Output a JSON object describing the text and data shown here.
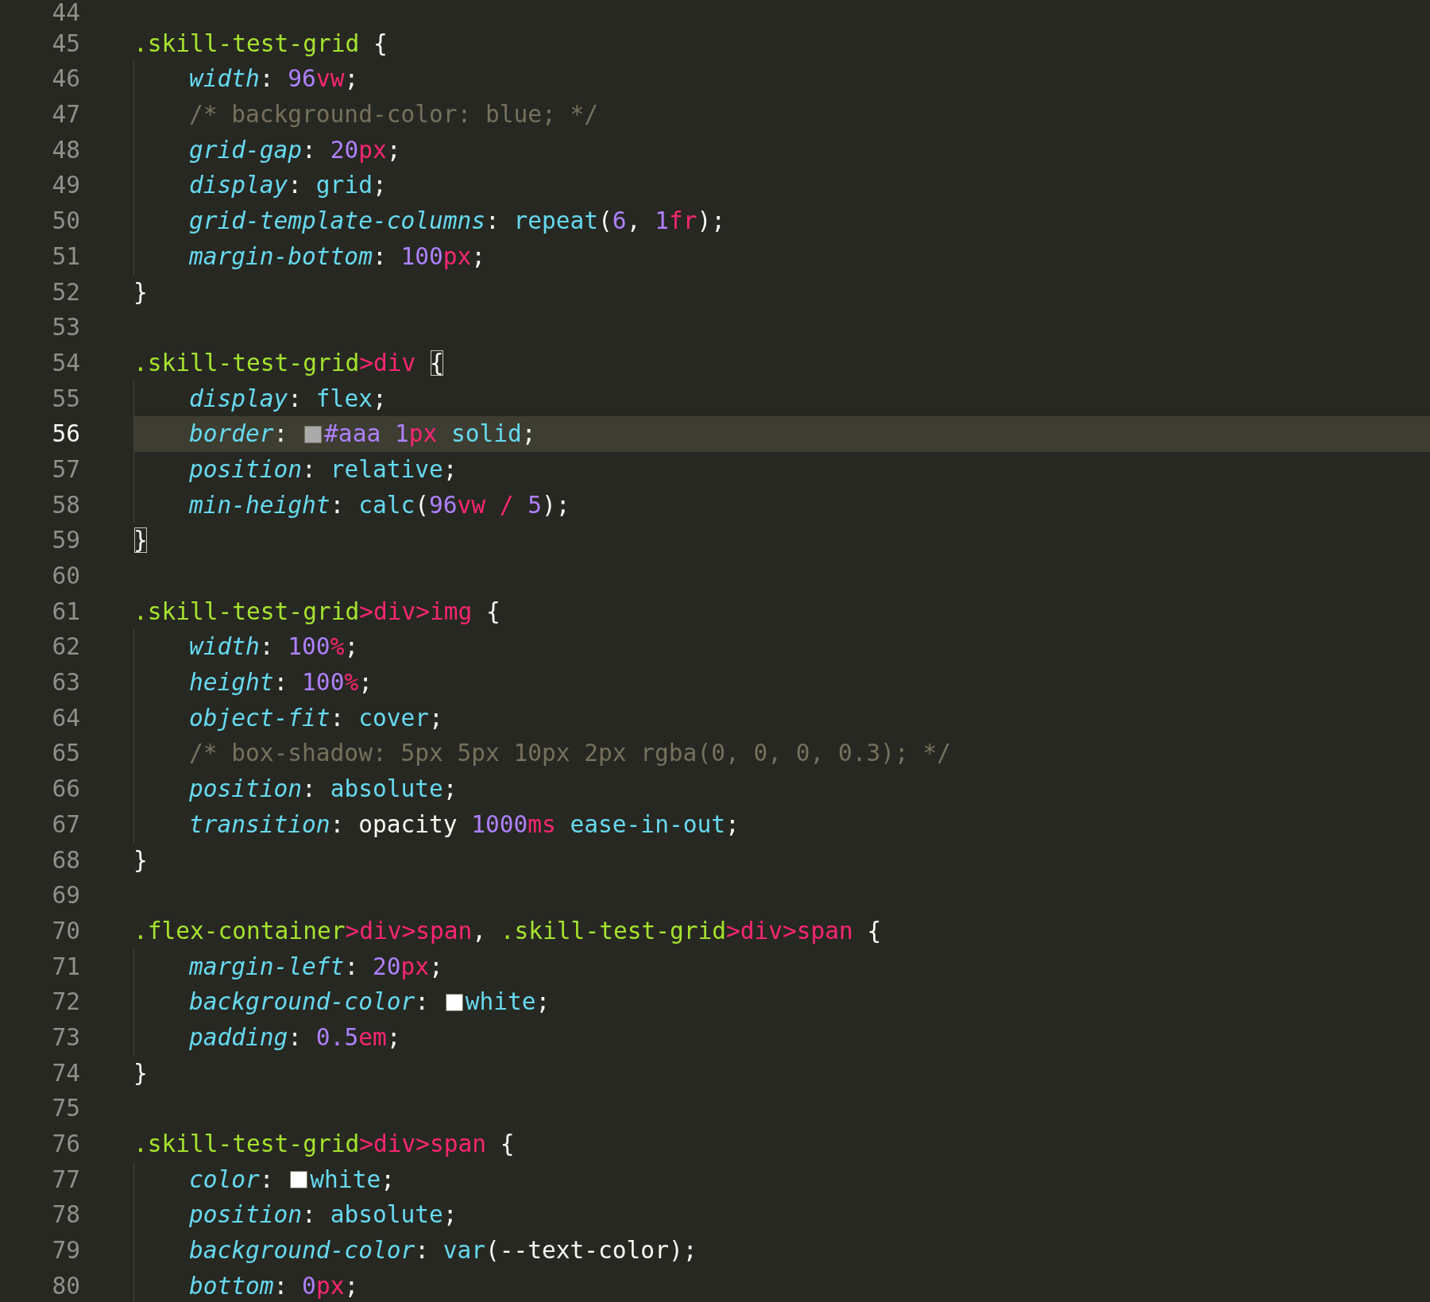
{
  "editor": {
    "lines": [
      {
        "number": "44",
        "current": false
      },
      {
        "number": "45",
        "current": false,
        "indented": false,
        "tokens": [
          {
            "kind": "selector",
            "text": ".skill-test-grid"
          },
          {
            "kind": "punct",
            "text": " {"
          }
        ]
      },
      {
        "number": "46",
        "current": false,
        "indented": true,
        "tokens": [
          {
            "kind": "property",
            "text": "width"
          },
          {
            "kind": "punct",
            "text": ": "
          },
          {
            "kind": "number",
            "text": "96"
          },
          {
            "kind": "unit",
            "text": "vw"
          },
          {
            "kind": "punct",
            "text": ";"
          }
        ]
      },
      {
        "number": "47",
        "current": false,
        "indented": true,
        "tokens": [
          {
            "kind": "comment",
            "text": "/* background-color: blue; */"
          }
        ]
      },
      {
        "number": "48",
        "current": false,
        "indented": true,
        "tokens": [
          {
            "kind": "property",
            "text": "grid-gap"
          },
          {
            "kind": "punct",
            "text": ": "
          },
          {
            "kind": "number",
            "text": "20"
          },
          {
            "kind": "unit",
            "text": "px"
          },
          {
            "kind": "punct",
            "text": ";"
          }
        ]
      },
      {
        "number": "49",
        "current": false,
        "indented": true,
        "tokens": [
          {
            "kind": "property",
            "text": "display"
          },
          {
            "kind": "punct",
            "text": ": "
          },
          {
            "kind": "keyword",
            "text": "grid"
          },
          {
            "kind": "punct",
            "text": ";"
          }
        ]
      },
      {
        "number": "50",
        "current": false,
        "indented": true,
        "tokens": [
          {
            "kind": "property",
            "text": "grid-template-columns"
          },
          {
            "kind": "punct",
            "text": ": "
          },
          {
            "kind": "keyword",
            "text": "repeat"
          },
          {
            "kind": "punct",
            "text": "("
          },
          {
            "kind": "number",
            "text": "6"
          },
          {
            "kind": "punct",
            "text": ", "
          },
          {
            "kind": "number",
            "text": "1"
          },
          {
            "kind": "unit",
            "text": "fr"
          },
          {
            "kind": "punct",
            "text": ");"
          }
        ]
      },
      {
        "number": "51",
        "current": false,
        "indented": true,
        "tokens": [
          {
            "kind": "property",
            "text": "margin-bottom"
          },
          {
            "kind": "punct",
            "text": ": "
          },
          {
            "kind": "number",
            "text": "100"
          },
          {
            "kind": "unit",
            "text": "px"
          },
          {
            "kind": "punct",
            "text": ";"
          }
        ]
      },
      {
        "number": "52",
        "current": false,
        "indented": false,
        "tokens": [
          {
            "kind": "punct",
            "text": "}"
          }
        ]
      },
      {
        "number": "53",
        "current": false
      },
      {
        "number": "54",
        "current": false,
        "indented": false,
        "tokens": [
          {
            "kind": "selector",
            "text": ".skill-test-grid"
          },
          {
            "kind": "unit",
            "text": ">div "
          },
          {
            "kind": "punct",
            "text": "{",
            "matched": true
          }
        ]
      },
      {
        "number": "55",
        "current": false,
        "indented": true,
        "tokens": [
          {
            "kind": "property",
            "text": "display"
          },
          {
            "kind": "punct",
            "text": ": "
          },
          {
            "kind": "keyword",
            "text": "flex"
          },
          {
            "kind": "punct",
            "text": ";"
          }
        ]
      },
      {
        "number": "56",
        "current": true,
        "indented": true,
        "tokens": [
          {
            "kind": "property",
            "text": "border"
          },
          {
            "kind": "punct",
            "text": ": "
          },
          {
            "kind": "swatch",
            "color": "#aaaaaa"
          },
          {
            "kind": "number",
            "text": "#aaa "
          },
          {
            "kind": "number",
            "text": "1"
          },
          {
            "kind": "unit",
            "text": "px "
          },
          {
            "kind": "keyword",
            "text": "solid"
          },
          {
            "kind": "punct",
            "text": ";"
          }
        ]
      },
      {
        "number": "57",
        "current": false,
        "indented": true,
        "tokens": [
          {
            "kind": "property",
            "text": "position"
          },
          {
            "kind": "punct",
            "text": ": "
          },
          {
            "kind": "keyword",
            "text": "relative"
          },
          {
            "kind": "punct",
            "text": ";"
          }
        ]
      },
      {
        "number": "58",
        "current": false,
        "indented": true,
        "tokens": [
          {
            "kind": "property",
            "text": "min-height"
          },
          {
            "kind": "punct",
            "text": ": "
          },
          {
            "kind": "keyword",
            "text": "calc"
          },
          {
            "kind": "punct",
            "text": "("
          },
          {
            "kind": "number",
            "text": "96"
          },
          {
            "kind": "unit",
            "text": "vw / "
          },
          {
            "kind": "number",
            "text": "5"
          },
          {
            "kind": "punct",
            "text": ");"
          }
        ]
      },
      {
        "number": "59",
        "current": false,
        "indented": false,
        "tokens": [
          {
            "kind": "punct",
            "text": "}",
            "matched": true
          }
        ]
      },
      {
        "number": "60",
        "current": false
      },
      {
        "number": "61",
        "current": false,
        "indented": false,
        "tokens": [
          {
            "kind": "selector",
            "text": ".skill-test-grid"
          },
          {
            "kind": "unit",
            "text": ">div>img"
          },
          {
            "kind": "punct",
            "text": " {"
          }
        ]
      },
      {
        "number": "62",
        "current": false,
        "indented": true,
        "tokens": [
          {
            "kind": "property",
            "text": "width"
          },
          {
            "kind": "punct",
            "text": ": "
          },
          {
            "kind": "number",
            "text": "100"
          },
          {
            "kind": "unit",
            "text": "%"
          },
          {
            "kind": "punct",
            "text": ";"
          }
        ]
      },
      {
        "number": "63",
        "current": false,
        "indented": true,
        "tokens": [
          {
            "kind": "property",
            "text": "height"
          },
          {
            "kind": "punct",
            "text": ": "
          },
          {
            "kind": "number",
            "text": "100"
          },
          {
            "kind": "unit",
            "text": "%"
          },
          {
            "kind": "punct",
            "text": ";"
          }
        ]
      },
      {
        "number": "64",
        "current": false,
        "indented": true,
        "tokens": [
          {
            "kind": "property",
            "text": "object-fit"
          },
          {
            "kind": "punct",
            "text": ": "
          },
          {
            "kind": "keyword",
            "text": "cover"
          },
          {
            "kind": "punct",
            "text": ";"
          }
        ]
      },
      {
        "number": "65",
        "current": false,
        "indented": true,
        "tokens": [
          {
            "kind": "comment",
            "text": "/* box-shadow: 5px 5px 10px 2px rgba(0, 0, 0, 0.3); */"
          }
        ]
      },
      {
        "number": "66",
        "current": false,
        "indented": true,
        "tokens": [
          {
            "kind": "property",
            "text": "position"
          },
          {
            "kind": "punct",
            "text": ": "
          },
          {
            "kind": "keyword",
            "text": "absolute"
          },
          {
            "kind": "punct",
            "text": ";"
          }
        ]
      },
      {
        "number": "67",
        "current": false,
        "indented": true,
        "tokens": [
          {
            "kind": "property",
            "text": "transition"
          },
          {
            "kind": "punct",
            "text": ": opacity "
          },
          {
            "kind": "number",
            "text": "1000"
          },
          {
            "kind": "unit",
            "text": "ms "
          },
          {
            "kind": "keyword",
            "text": "ease-in-out"
          },
          {
            "kind": "punct",
            "text": ";"
          }
        ]
      },
      {
        "number": "68",
        "current": false,
        "indented": false,
        "tokens": [
          {
            "kind": "punct",
            "text": "}"
          }
        ]
      },
      {
        "number": "69",
        "current": false
      },
      {
        "number": "70",
        "current": false,
        "indented": false,
        "tokens": [
          {
            "kind": "selector",
            "text": ".flex-container"
          },
          {
            "kind": "unit",
            "text": ">div>span"
          },
          {
            "kind": "punct",
            "text": ", "
          },
          {
            "kind": "selector",
            "text": ".skill-test-grid"
          },
          {
            "kind": "unit",
            "text": ">div>span"
          },
          {
            "kind": "punct",
            "text": " {"
          }
        ]
      },
      {
        "number": "71",
        "current": false,
        "indented": true,
        "tokens": [
          {
            "kind": "property",
            "text": "margin-left"
          },
          {
            "kind": "punct",
            "text": ": "
          },
          {
            "kind": "number",
            "text": "20"
          },
          {
            "kind": "unit",
            "text": "px"
          },
          {
            "kind": "punct",
            "text": ";"
          }
        ]
      },
      {
        "number": "72",
        "current": false,
        "indented": true,
        "tokens": [
          {
            "kind": "property",
            "text": "background-color"
          },
          {
            "kind": "punct",
            "text": ": "
          },
          {
            "kind": "swatch",
            "color": "#ffffff"
          },
          {
            "kind": "keyword",
            "text": "white"
          },
          {
            "kind": "punct",
            "text": ";"
          }
        ]
      },
      {
        "number": "73",
        "current": false,
        "indented": true,
        "tokens": [
          {
            "kind": "property",
            "text": "padding"
          },
          {
            "kind": "punct",
            "text": ": "
          },
          {
            "kind": "number",
            "text": "0.5"
          },
          {
            "kind": "unit",
            "text": "em"
          },
          {
            "kind": "punct",
            "text": ";"
          }
        ]
      },
      {
        "number": "74",
        "current": false,
        "indented": false,
        "tokens": [
          {
            "kind": "punct",
            "text": "}"
          }
        ]
      },
      {
        "number": "75",
        "current": false
      },
      {
        "number": "76",
        "current": false,
        "indented": false,
        "tokens": [
          {
            "kind": "selector",
            "text": ".skill-test-grid"
          },
          {
            "kind": "unit",
            "text": ">div>span"
          },
          {
            "kind": "punct",
            "text": " {"
          }
        ]
      },
      {
        "number": "77",
        "current": false,
        "indented": true,
        "tokens": [
          {
            "kind": "property",
            "text": "color"
          },
          {
            "kind": "punct",
            "text": ": "
          },
          {
            "kind": "swatch",
            "color": "#ffffff"
          },
          {
            "kind": "keyword",
            "text": "white"
          },
          {
            "kind": "punct",
            "text": ";"
          }
        ]
      },
      {
        "number": "78",
        "current": false,
        "indented": true,
        "tokens": [
          {
            "kind": "property",
            "text": "position"
          },
          {
            "kind": "punct",
            "text": ": "
          },
          {
            "kind": "keyword",
            "text": "absolute"
          },
          {
            "kind": "punct",
            "text": ";"
          }
        ]
      },
      {
        "number": "79",
        "current": false,
        "indented": true,
        "tokens": [
          {
            "kind": "property",
            "text": "background-color"
          },
          {
            "kind": "punct",
            "text": ": "
          },
          {
            "kind": "keyword",
            "text": "var"
          },
          {
            "kind": "punct",
            "text": "(--text-color);"
          }
        ]
      },
      {
        "number": "80",
        "current": false,
        "indented": true,
        "tokens": [
          {
            "kind": "property",
            "text": "bottom"
          },
          {
            "kind": "punct",
            "text": ": "
          },
          {
            "kind": "number",
            "text": "0"
          },
          {
            "kind": "unit",
            "text": "px"
          },
          {
            "kind": "punct",
            "text": ";"
          }
        ]
      }
    ]
  }
}
